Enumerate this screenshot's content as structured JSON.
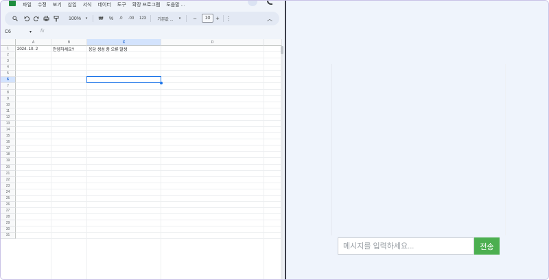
{
  "menu": [
    "파일",
    "수정",
    "보기",
    "삽입",
    "서식",
    "데이터",
    "도구",
    "확장 프로그램",
    "도움말 ..."
  ],
  "toolbar": {
    "zoom": "100%",
    "currency": "₩",
    "percent": "%",
    "decimal_down": ".0",
    "decimal_up": ".00",
    "number_format": "123",
    "font": "기본값 ...",
    "font_size": "10",
    "minus": "−",
    "plus": "+",
    "more": "⋮",
    "collapse": "︿"
  },
  "name_box": "C6",
  "fx": "fx",
  "columns": [
    "A",
    "B",
    "C",
    "D"
  ],
  "rows": [
    "1",
    "2",
    "3",
    "4",
    "5",
    "6",
    "7",
    "8",
    "9",
    "10",
    "11",
    "12",
    "13",
    "14",
    "15",
    "16",
    "17",
    "18",
    "19",
    "20",
    "21",
    "22",
    "23",
    "24",
    "25",
    "26",
    "27",
    "28",
    "29",
    "30",
    "31"
  ],
  "cells": {
    "A1": "2024. 10. 2",
    "B1": "안녕하세요?",
    "C1": "응답 생성 중 오류 발생"
  },
  "chat": {
    "placeholder": "메시지를 입력하세요...",
    "send_label": "전송"
  },
  "colors": {
    "accent": "#1a73e8",
    "send": "#4caf50",
    "sheets_green": "#1e8e3e"
  }
}
